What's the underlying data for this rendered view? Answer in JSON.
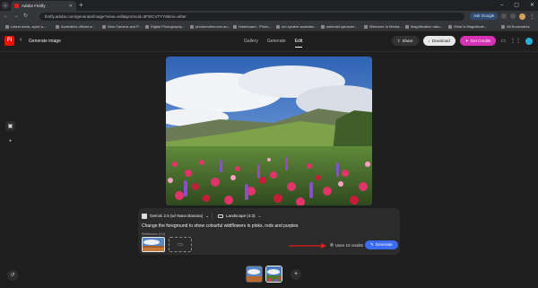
{
  "browser": {
    "tab_title": "Adobe Firefly",
    "url": "firefly.adobe.com/generate/image?view=edit&promoid=3FWCVTYY8kmv=other",
    "ask_google": "Ask Google",
    "bookmarks": [
      "Latest news, sport a...",
      "Australia's official w...",
      "New Camera and P...",
      "Digital Photography...",
      "photoreview.com.au...",
      "Dashboard - Photo...",
      "om system australia...",
      "webmail.optusnet...",
      "Welcome to Media...",
      "Magnification ratio...",
      "What is Magnificati..."
    ],
    "all_bookmarks": "All Bookmarks"
  },
  "app": {
    "logo": "Fi",
    "page_title": "Generate image",
    "nav": [
      "Gallery",
      "Generate",
      "Edit"
    ],
    "active_nav": "Edit",
    "share": "Share",
    "download": "Download",
    "get_credits": "Get Credits"
  },
  "prompt_panel": {
    "model": "Gemini 2.5 (w/ Nano Banana)",
    "aspect": "Landscape (4:3)",
    "prompt": "Change the foreground to show colourful wildflowers in pinks, reds and purples",
    "references_label": "References (1/4)",
    "uses_credits": "Uses 10 credits",
    "generate": "Generate"
  },
  "colors": {
    "accent_blue": "#3c6df0",
    "credits_magenta": "#d832b4",
    "annotation_arrow": "#e0201b",
    "adobe_red": "#eb1000"
  }
}
